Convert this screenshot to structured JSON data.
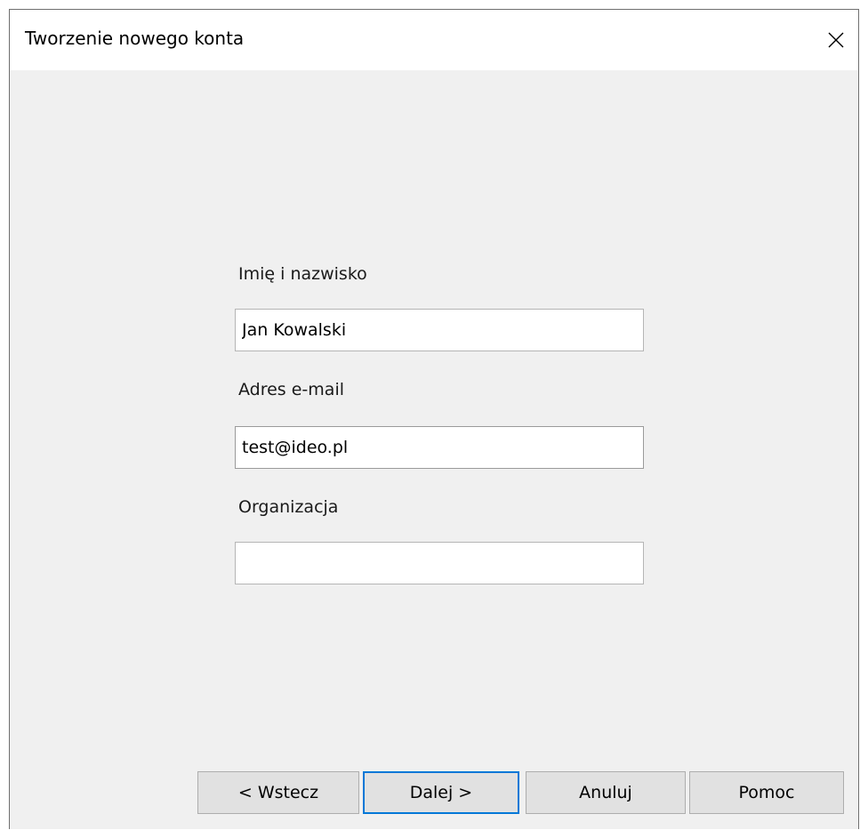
{
  "window": {
    "title": "Tworzenie nowego konta",
    "close_icon": "close-icon"
  },
  "form": {
    "name_label": "Imię i nazwisko",
    "name_value": "Jan Kowalski",
    "email_label": "Adres e-mail",
    "email_value": "test@ideo.pl",
    "org_label": "Organizacja",
    "org_value": ""
  },
  "buttons": {
    "back_label": "< Wstecz",
    "next_label": "Dalej >",
    "cancel_label": "Anuluj",
    "help_label": "Pomoc"
  },
  "colors": {
    "accent": "#0078d7",
    "dialog_background": "#f0f0f0",
    "button_background": "#e1e1e1"
  }
}
